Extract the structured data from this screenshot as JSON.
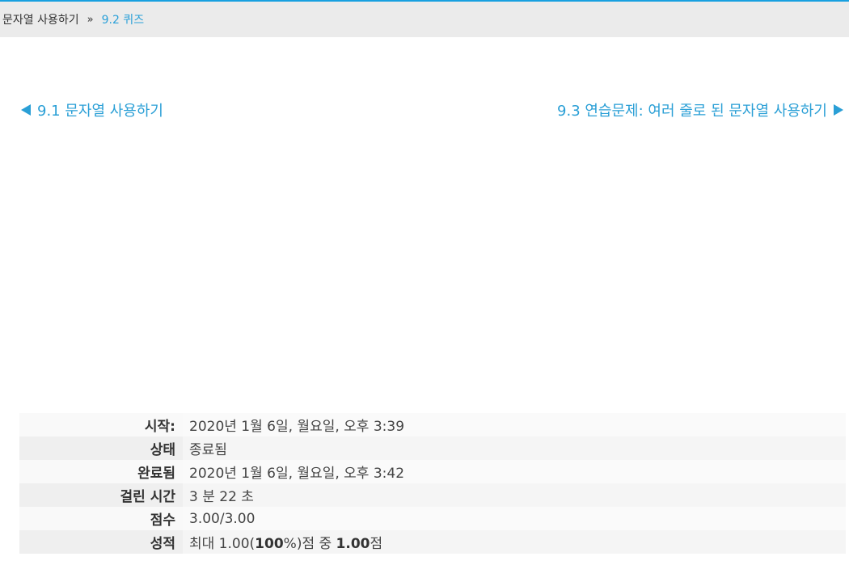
{
  "breadcrumb": {
    "parent": "문자열 사용하기",
    "separator": "»",
    "current": "9.2 퀴즈"
  },
  "nav": {
    "prev": "9.1 문자열 사용하기",
    "next": "9.3 연습문제: 여러 줄로 된 문자열 사용하기"
  },
  "summary": {
    "rows": [
      {
        "label": "시작:",
        "value": "2020년 1월 6일, 월요일, 오후 3:39"
      },
      {
        "label": "상태",
        "value": "종료됨"
      },
      {
        "label": "완료됨",
        "value": "2020년 1월 6일, 월요일, 오후 3:42"
      },
      {
        "label": "걸린 시간",
        "value": "3 분 22 초"
      },
      {
        "label": "점수",
        "value": "3.00/3.00"
      }
    ],
    "grade": {
      "label": "성적",
      "prefix": "최대 1.00(",
      "percent": "100",
      "percent_suffix": "%)점 중 ",
      "score": "1.00",
      "suffix": "점"
    }
  },
  "colors": {
    "accent": "#2a9fd6",
    "top_line": "#18a0e0",
    "breadcrumb_bg": "#ebebeb"
  },
  "icons": {
    "prev": "triangle-left-icon",
    "next": "triangle-right-icon"
  }
}
